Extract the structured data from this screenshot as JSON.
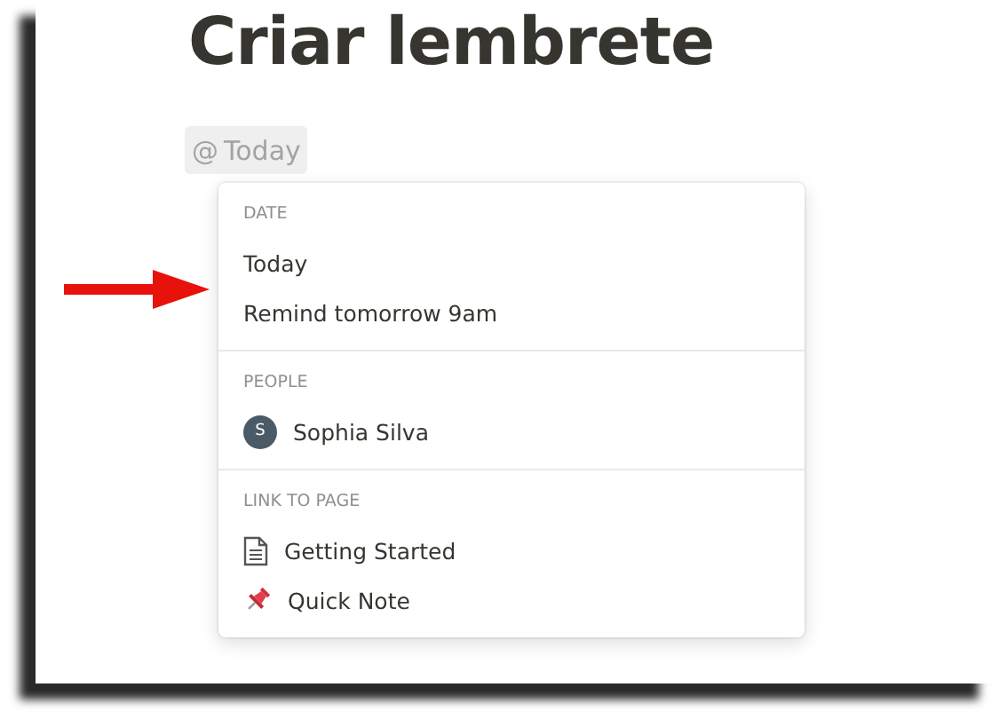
{
  "title": "Criar lembrete",
  "mention": {
    "symbol": "@",
    "label": "Today"
  },
  "menu": {
    "sections": [
      {
        "heading": "DATE",
        "items": [
          {
            "kind": "text",
            "label": "Today"
          },
          {
            "kind": "text",
            "label": "Remind tomorrow 9am"
          }
        ]
      },
      {
        "heading": "PEOPLE",
        "items": [
          {
            "kind": "person",
            "initial": "S",
            "label": "Sophia Silva"
          }
        ]
      },
      {
        "heading": "LINK TO PAGE",
        "items": [
          {
            "kind": "page",
            "label": "Getting Started"
          },
          {
            "kind": "pin",
            "label": "Quick Note"
          }
        ]
      }
    ]
  }
}
